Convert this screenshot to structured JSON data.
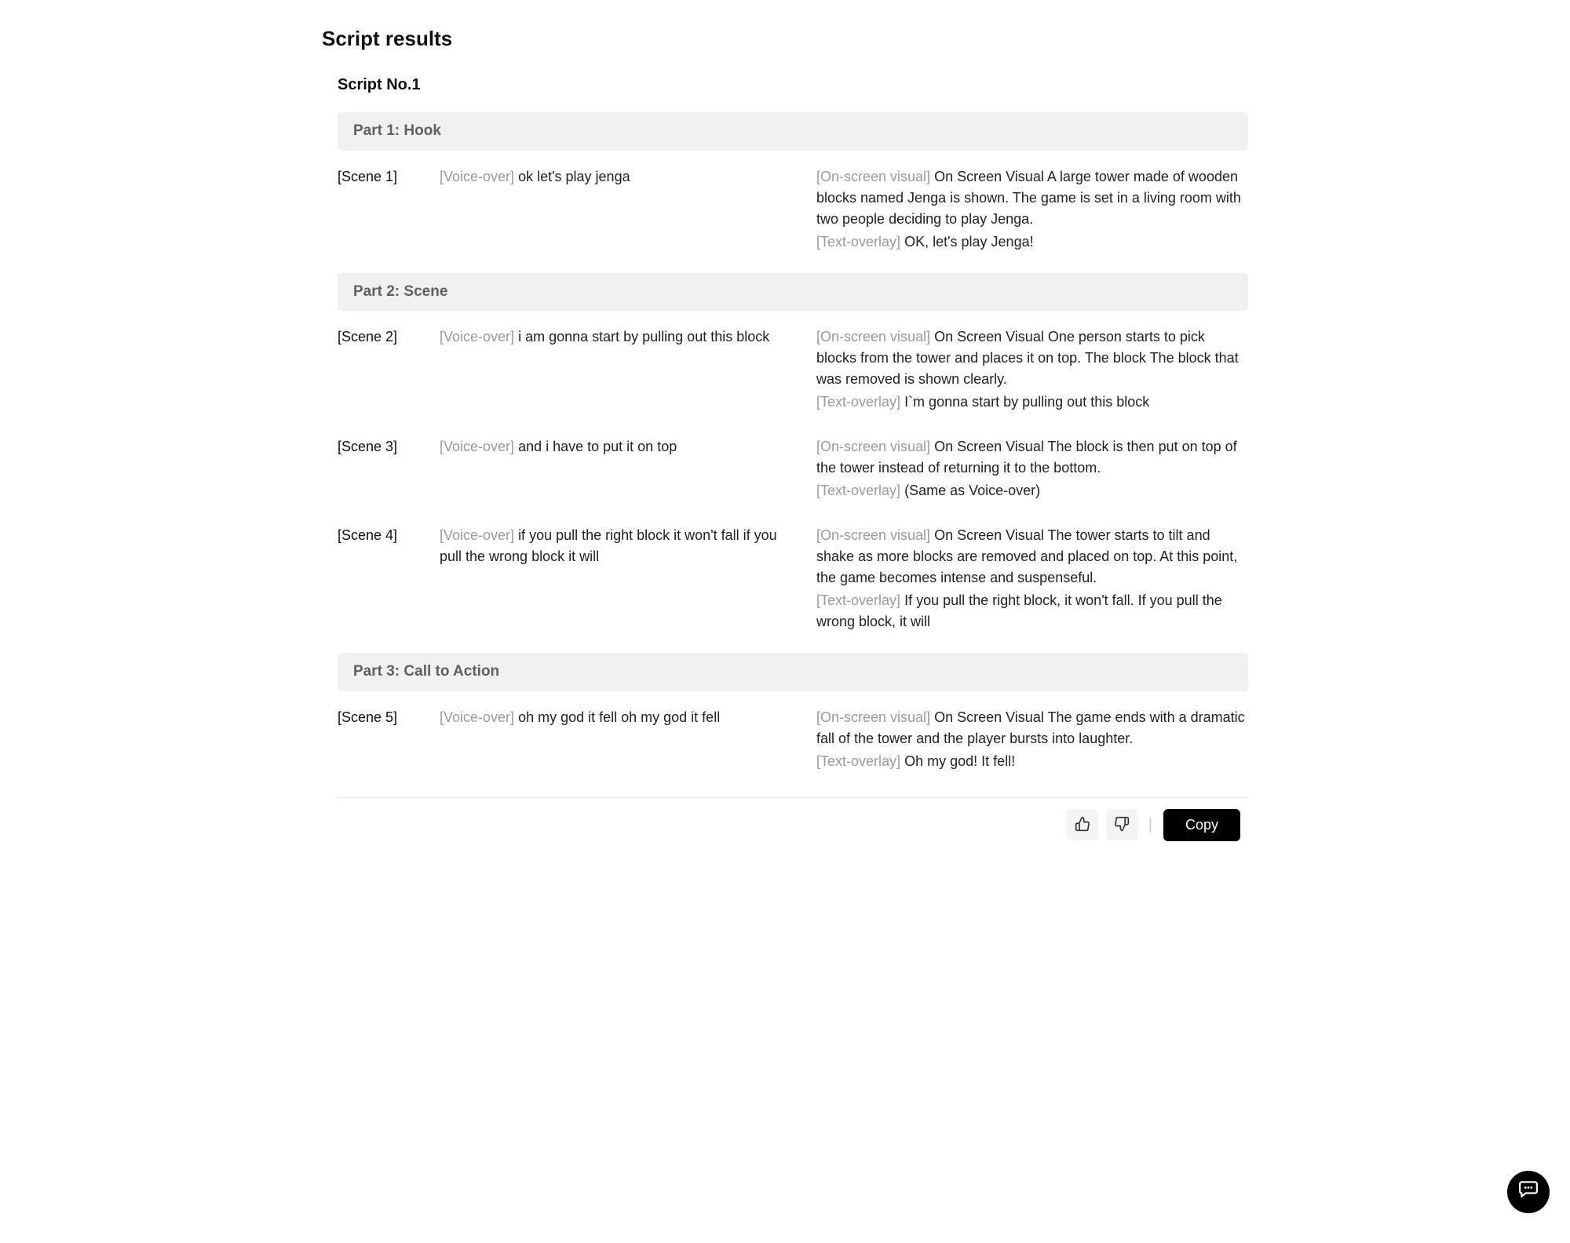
{
  "page_title": "Script results",
  "script_title": "Script No.1",
  "labels": {
    "voice_over": "[Voice-over]",
    "on_screen_visual": "[On-screen visual]",
    "text_overlay": "[Text-overlay]"
  },
  "parts": [
    {
      "title": "Part 1: Hook",
      "scenes": [
        {
          "label": "[Scene 1]",
          "voice_over": "ok let's play jenga",
          "on_screen_visual": "On Screen Visual A large tower made of wooden blocks named Jenga is shown. The game is set in a living room with two people deciding to play Jenga.",
          "text_overlay": "OK, let's play Jenga!"
        }
      ]
    },
    {
      "title": "Part 2: Scene",
      "scenes": [
        {
          "label": "[Scene 2]",
          "voice_over": "i am gonna start by pulling out this block",
          "on_screen_visual": "On Screen Visual One person starts to pick blocks from the tower and places it on top. The block The block that was removed is shown clearly.",
          "text_overlay": "I`m gonna start by pulling out this block"
        },
        {
          "label": "[Scene 3]",
          "voice_over": "and i have to put it on top",
          "on_screen_visual": "On Screen Visual The block is then put on top of the tower instead of returning it to the bottom.",
          "text_overlay": "(Same as Voice-over)"
        },
        {
          "label": "[Scene 4]",
          "voice_over": "if you pull the right block it won't fall if you pull the wrong block it will",
          "on_screen_visual": "On Screen Visual The tower starts to tilt and shake as more blocks are removed and placed on top. At this point, the game becomes intense and suspenseful.",
          "text_overlay": "If you pull the right block, it won't fall. If you pull the wrong block, it will"
        }
      ]
    },
    {
      "title": "Part 3: Call to Action",
      "scenes": [
        {
          "label": "[Scene 5]",
          "voice_over": "oh my god it fell oh my god it fell",
          "on_screen_visual": "On Screen Visual The game ends with a dramatic fall of the tower and the player bursts into laughter.",
          "text_overlay": "Oh my god! It fell!"
        }
      ]
    }
  ],
  "buttons": {
    "copy": "Copy"
  }
}
